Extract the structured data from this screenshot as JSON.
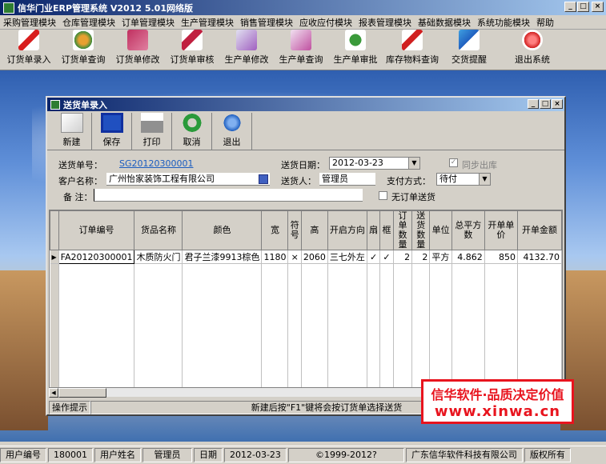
{
  "app": {
    "title": "信华门业ERP管理系统   V2012   5.01网络版",
    "window_buttons": [
      "_",
      "□",
      "×"
    ]
  },
  "menu": [
    "采购管理模块",
    "仓库管理模块",
    "订单管理模块",
    "生产管理模块",
    "销售管理模块",
    "应收应付模块",
    "报表管理模块",
    "基础数据模块",
    "系统功能模块",
    "帮助"
  ],
  "toolbar": [
    "订货单录入",
    "订货单查询",
    "订货单修改",
    "订货单审核",
    "生产单修改",
    "生产单查询",
    "生产单审批",
    "库存物料查询",
    "交货提醒",
    "退出系统"
  ],
  "child": {
    "title": "送货单录入",
    "window_buttons": [
      "_",
      "□",
      "×"
    ],
    "tools": [
      "新建",
      "保存",
      "打印",
      "取消",
      "退出"
    ],
    "form": {
      "order_no_label": "送货单号：",
      "order_no": "SG20120300001",
      "date_label": "送货日期：",
      "date": "2012-03-23",
      "sync_label": "同步出库",
      "customer_label": "客户名称：",
      "customer": "广州怡家装饰工程有限公司",
      "deliverer_label": "送货人：",
      "deliverer": "管理员",
      "pay_label": "支付方式：",
      "pay": "待付",
      "note_label": "备  注：",
      "note": "",
      "no_order_label": "无订单送货"
    },
    "grid": {
      "headers": [
        "订单编号",
        "货品名称",
        "颜色",
        "宽",
        "符号",
        "高",
        "开启方向",
        "扇",
        "框",
        "订单数量",
        "送货数量",
        "单位",
        "总平方数",
        "开单单价",
        "开单金额"
      ],
      "rows": [
        [
          "FA20120300001",
          "木质防火门",
          "君子兰漆9913棕色",
          "1180",
          "×",
          "2060",
          "三七外左",
          "✓",
          "✓",
          "2",
          "2",
          "平方",
          "4.862",
          "850",
          "4132.70"
        ]
      ]
    },
    "hint_label": "操作提示",
    "hint": "新建后按\"F1\"键将会按订货单选择送货"
  },
  "promo": {
    "line1": "信华软件·品质决定价值",
    "line2": "www.xinwa.cn"
  },
  "status": {
    "user_no_label": "用户编号",
    "user_no": "180001",
    "user_name_label": "用户姓名",
    "user_name": "管理员",
    "date_label": "日期",
    "date": "2012-03-23",
    "copyright": "©1999-2012?",
    "company": "广东信华软件科技有限公司",
    "rights": "版权所有"
  },
  "colors": {
    "title_bar": "#0a246a",
    "sum_row": "#ffff00",
    "promo_red": "#e8141e"
  }
}
